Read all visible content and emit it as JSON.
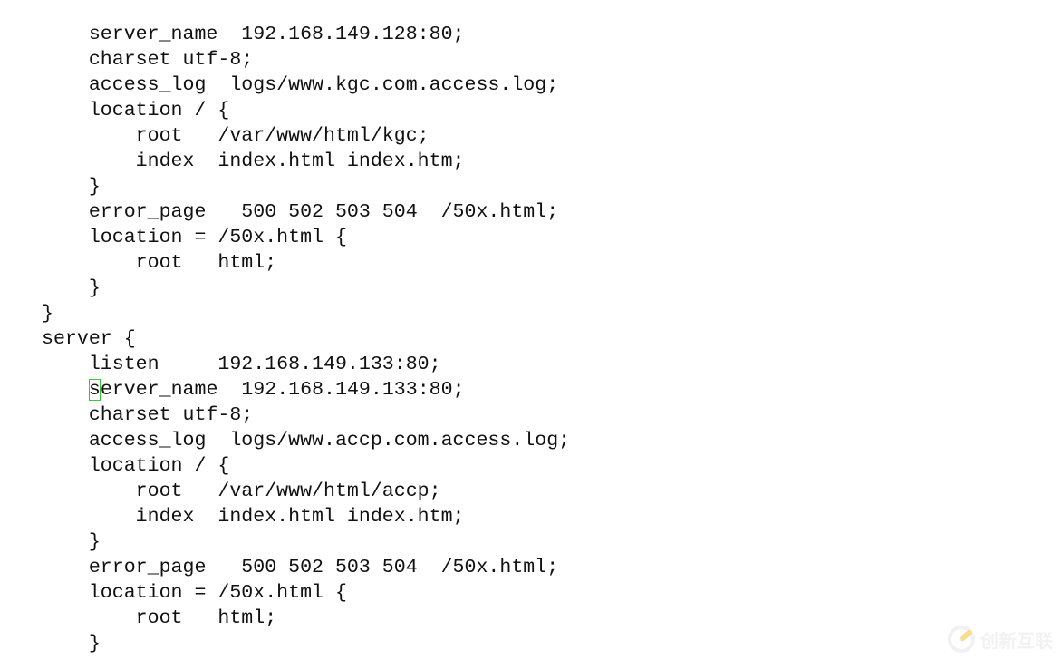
{
  "editor": {
    "lines": [
      "    server_name  192.168.149.128:80;",
      "    charset utf-8;",
      "    access_log  logs/www.kgc.com.access.log;",
      "    location / {",
      "        root   /var/www/html/kgc;",
      "        index  index.html index.htm;",
      "    }",
      "    error_page   500 502 503 504  /50x.html;",
      "    location = /50x.html {",
      "        root   html;",
      "    }",
      "}",
      "server {",
      "    listen     192.168.149.133:80;",
      "    server_name  192.168.149.133:80;",
      "    charset utf-8;",
      "    access_log  logs/www.accp.com.access.log;",
      "    location / {",
      "        root   /var/www/html/accp;",
      "        index  index.html index.htm;",
      "    }",
      "    error_page   500 502 503 504  /50x.html;",
      "    location = /50x.html {",
      "        root   html;",
      "    }"
    ],
    "cursor": {
      "line": 14,
      "column": 4
    },
    "cursor_color": "#3cc23c"
  },
  "watermark": {
    "text": "创新互联"
  }
}
